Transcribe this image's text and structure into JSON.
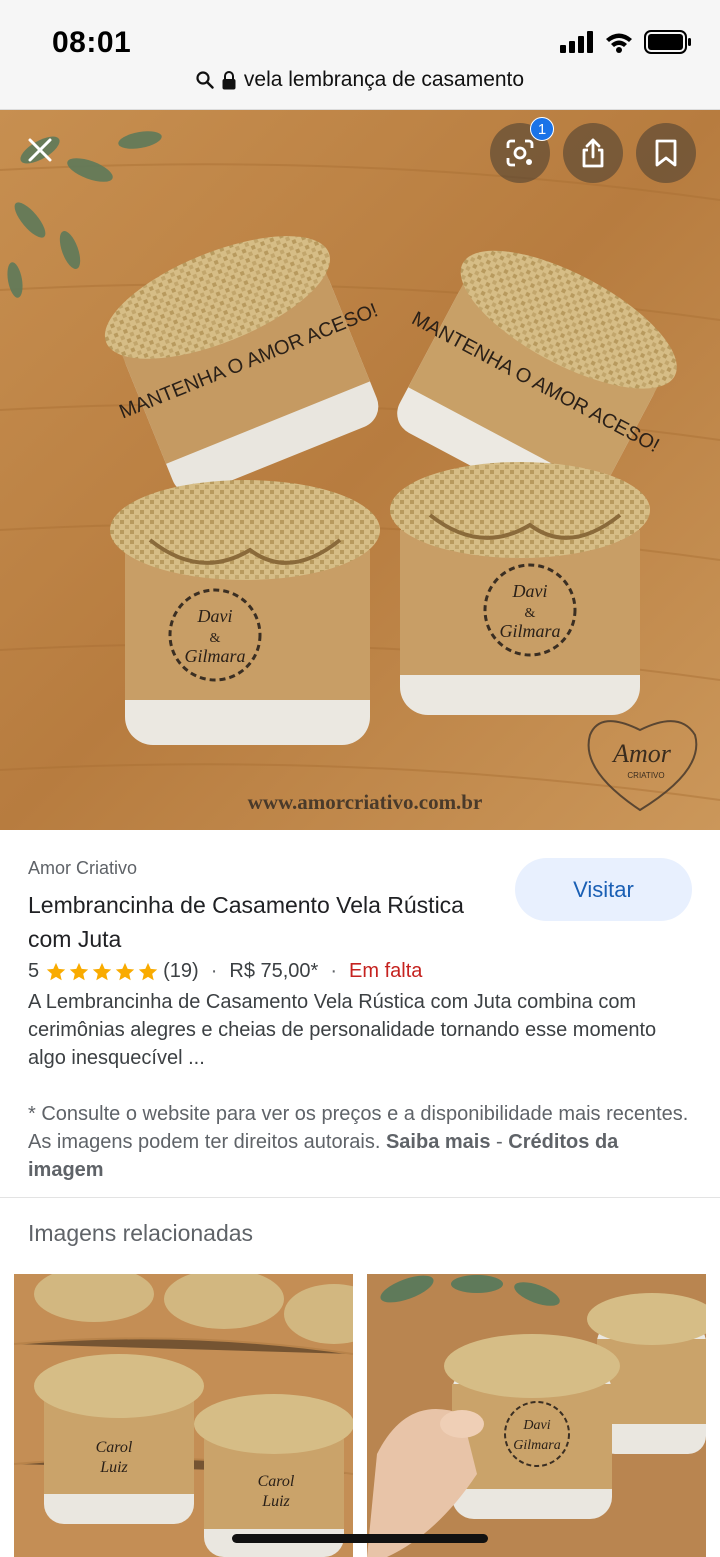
{
  "status_bar": {
    "time": "08:01",
    "icons": [
      "signal-icon",
      "wifi-icon",
      "battery-icon"
    ]
  },
  "url_bar": {
    "query": "vela lembrança de casamento",
    "icons": [
      "search-icon",
      "lock-icon"
    ]
  },
  "viewer": {
    "close_icon": "close-icon",
    "lens_badge_count": "1",
    "actions": [
      "lens-icon",
      "share-icon",
      "bookmark-icon"
    ],
    "image": {
      "label_text_1": "MANTENHA O AMOR ACESO!",
      "label_name_1": "Davi",
      "label_name_2": "Gilmara",
      "ampersand": "&",
      "watermark_url": "www.amorcriativo.com.br",
      "logo_text": "Amor",
      "logo_subtext": "CRIATIVO"
    }
  },
  "result": {
    "source": "Amor Criativo",
    "title": "Lembrancinha de Casamento Vela Rústica com Juta",
    "visit_label": "Visitar",
    "rating_value": "5",
    "rating_stars": 5,
    "rating_count": "(19)",
    "separator": "·",
    "price": "R$ 75,00*",
    "stock": "Em falta",
    "description": "A Lembrancinha de Casamento Vela Rústica com Juta combina com cerimônias alegres e cheias de personalidade tornando esse momento algo inesquecível ...",
    "note_text": "* Consulte o website para ver os preços e a disponibilidade mais recentes. As imagens podem ter direitos autorais.",
    "note_link_1": "Saiba mais",
    "note_sep": " - ",
    "note_link_2": "Créditos da imagem"
  },
  "related": {
    "title": "Imagens relacionadas",
    "thumb_1": {
      "name_top": "Carol",
      "name_bottom": "Luiz"
    },
    "thumb_2": {
      "name_top": "Davi",
      "name_bottom": "Gilmara"
    }
  },
  "colors": {
    "accent": "#1a73e8",
    "visit_bg": "#e8f0fe",
    "stock_red": "#c5221f",
    "star": "#f9ab00",
    "wood": "#c08a4e",
    "kraft": "#c9a06a",
    "burlap": "#d8c08a"
  }
}
